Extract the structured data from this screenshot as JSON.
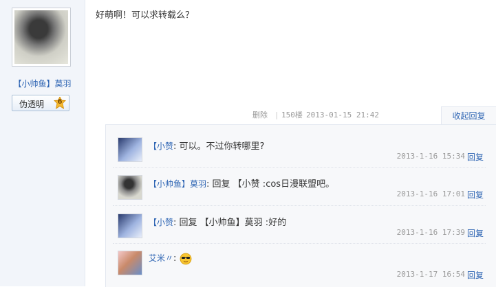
{
  "author": {
    "username": "【小帅鱼】莫羽",
    "badge_name": "伪透明",
    "badge_level": "6"
  },
  "post": {
    "content": "好萌啊！可以求转载么？",
    "delete_label": "删除",
    "separator": "|",
    "floor": "150楼",
    "time": "2013-01-15 21:42",
    "collapse_label": "收起回复"
  },
  "replies": [
    {
      "user": "【小赞",
      "colon": ":",
      "content": "可以。不过你转哪里?",
      "time": "2013-1-16 15:34",
      "reply_label": "回复"
    },
    {
      "user": "【小帅鱼】莫羽",
      "colon": ":",
      "content": "回复 【小赞 :cos日漫联盟吧。",
      "time": "2013-1-16 17:01",
      "reply_label": "回复"
    },
    {
      "user": "【小赞",
      "colon": ":",
      "content": "回复 【小帅鱼】莫羽 :好的",
      "time": "2013-1-16 17:39",
      "reply_label": "回复"
    },
    {
      "user": "艾米〃",
      "colon": ":",
      "content": "",
      "emoji": "sunglasses-face-icon",
      "time": "2013-1-17 16:54",
      "reply_label": "回复"
    }
  ]
}
